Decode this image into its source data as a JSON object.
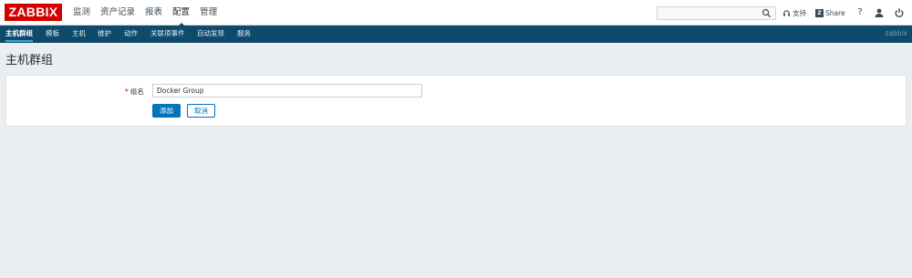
{
  "header": {
    "logo": "ZABBIX",
    "menu": [
      {
        "label": "监测"
      },
      {
        "label": "资产记录"
      },
      {
        "label": "报表"
      },
      {
        "label": "配置"
      },
      {
        "label": "管理"
      }
    ],
    "search": {
      "value": "",
      "placeholder": ""
    },
    "support_label": "支持",
    "share_label": "Share",
    "share_badge": "Z",
    "help_label": "?"
  },
  "subnav": {
    "items": [
      {
        "label": "主机群组"
      },
      {
        "label": "模板"
      },
      {
        "label": "主机"
      },
      {
        "label": "维护"
      },
      {
        "label": "动作"
      },
      {
        "label": "关联项事件"
      },
      {
        "label": "自动发现"
      },
      {
        "label": "服务"
      }
    ],
    "brand": "zabbix"
  },
  "page": {
    "title": "主机群组"
  },
  "form": {
    "required_mark": "*",
    "group_name_label": "组名",
    "group_name_value": "Docker Group",
    "add_label": "添加",
    "cancel_label": "取消"
  },
  "colors": {
    "logo_red": "#d40000",
    "subnav_bg": "#0e4a6b",
    "primary_blue": "#0275b8"
  }
}
